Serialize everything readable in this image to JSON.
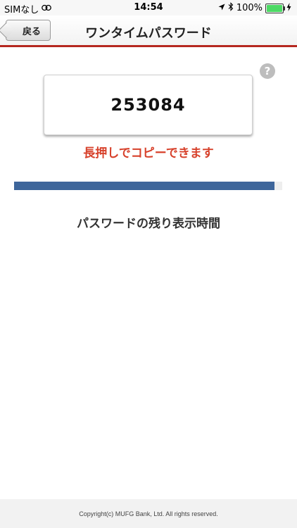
{
  "status_bar": {
    "carrier": "SIMなし",
    "time": "14:54",
    "battery_percent": "100%",
    "icons": [
      "link-icon",
      "location-icon",
      "bluetooth-icon",
      "battery-icon",
      "charging-icon"
    ]
  },
  "nav": {
    "back_label": "戻る",
    "title": "ワンタイムパスワード"
  },
  "help": {
    "symbol": "?"
  },
  "otp": {
    "value": "253084",
    "hint": "長押しでコピーできます"
  },
  "progress": {
    "remaining_fraction": 0.97,
    "fill_color": "#3e669b",
    "label": "パスワードの残り表示時間"
  },
  "footer": {
    "copyright": "Copyright(c) MUFG Bank, Ltd. All rights reserved."
  },
  "colors": {
    "accent_red": "#b5271f",
    "hint_red": "#d7412b"
  }
}
